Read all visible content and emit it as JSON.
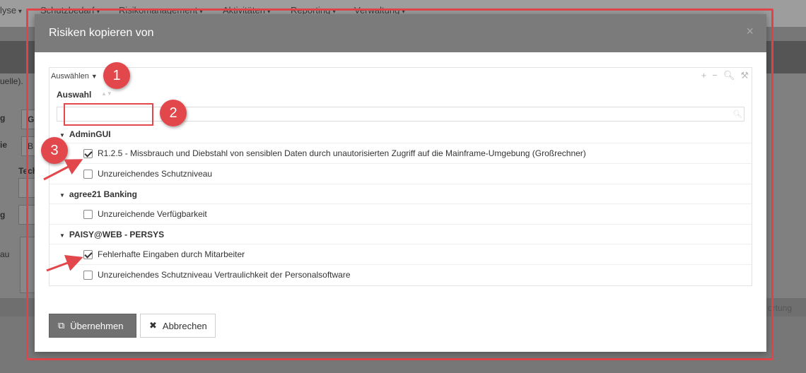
{
  "background": {
    "nav": [
      "lyse",
      "Schutzbedarf",
      "Risikomanagement",
      "Aktivitäten",
      "Reporting",
      "Verwaltung"
    ],
    "fragments": [
      "uelle).",
      "g",
      "ie",
      "Tech",
      "g",
      "au",
      "R",
      "G",
      "B",
      "ortung"
    ]
  },
  "modal": {
    "title": "Risiken kopieren von",
    "close": "×",
    "toolbar_label": "Auswählen",
    "column_header": "Auswahl",
    "filter_placeholder": "",
    "groups": [
      {
        "name": "AdminGUI",
        "items": [
          {
            "label": "R1.2.5 - Missbrauch und Diebstahl von sensiblen Daten durch unautorisierten Zugriff auf die Mainframe-Umgebung (Großrechner)",
            "checked": true
          },
          {
            "label": "Unzureichendes Schutzniveau",
            "checked": false
          }
        ]
      },
      {
        "name": "agree21 Banking",
        "items": [
          {
            "label": "Unzureichende Verfügbarkeit",
            "checked": false
          }
        ]
      },
      {
        "name": "PAISY@WEB - PERSYS",
        "items": [
          {
            "label": "Fehlerhafte Eingaben durch Mitarbeiter",
            "checked": true
          },
          {
            "label": "Unzureichendes Schutzniveau Vertraulichkeit der Personalsoftware",
            "checked": false
          }
        ]
      }
    ],
    "buttons": {
      "apply": "Übernehmen",
      "cancel": "Abbrechen"
    }
  },
  "callouts": [
    "1",
    "2",
    "3"
  ],
  "colors": {
    "accent_red": "#e2474b",
    "header_gray": "#7b7b7b",
    "primary_button": "#717171"
  }
}
